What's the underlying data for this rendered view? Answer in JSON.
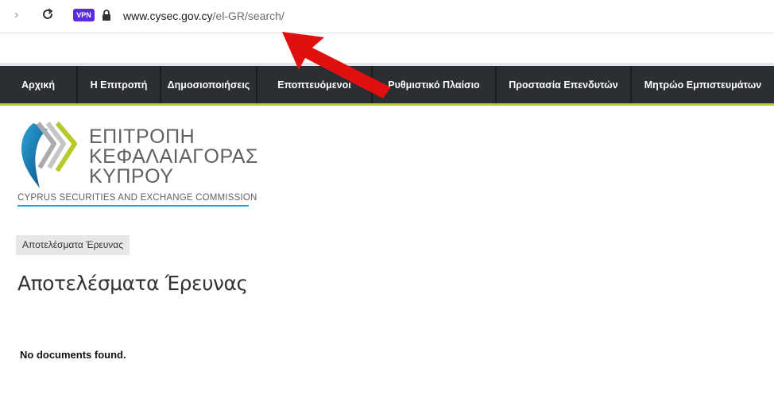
{
  "browser": {
    "url_domain": "www.cysec.gov.cy",
    "url_path": "/el-GR/search/",
    "vpn_label": "VPN"
  },
  "nav": {
    "items": [
      {
        "label": "Αρχική"
      },
      {
        "label": "Η Επιτροπή"
      },
      {
        "label": "Δημοσιοποιήσεις"
      },
      {
        "label": "Εποπτευόμενοι"
      },
      {
        "label": "Ρυθμιστικό Πλαίσιο"
      },
      {
        "label": "Προστασία Επενδυτών"
      },
      {
        "label": "Μητρώο Εμπιστευμάτων"
      }
    ]
  },
  "logo": {
    "line1": "ΕΠΙΤΡΟΠΗ",
    "line2": "ΚΕΦΑΛΑΙΑΓΟΡΑΣ",
    "line3": "ΚΥΠΡΟΥ",
    "subtitle": "CYPRUS SECURITIES AND EXCHANGE COMMISSION"
  },
  "breadcrumb": "Αποτελέσματα Έρευνας",
  "page_title": "Αποτελέσματα Έρευνας",
  "result_message": "No documents found.",
  "colors": {
    "nav_bg": "#2b2e33",
    "nav_accent": "#b8c92c",
    "vpn_badge": "#5b2be0",
    "annotation_arrow": "#e01010"
  }
}
